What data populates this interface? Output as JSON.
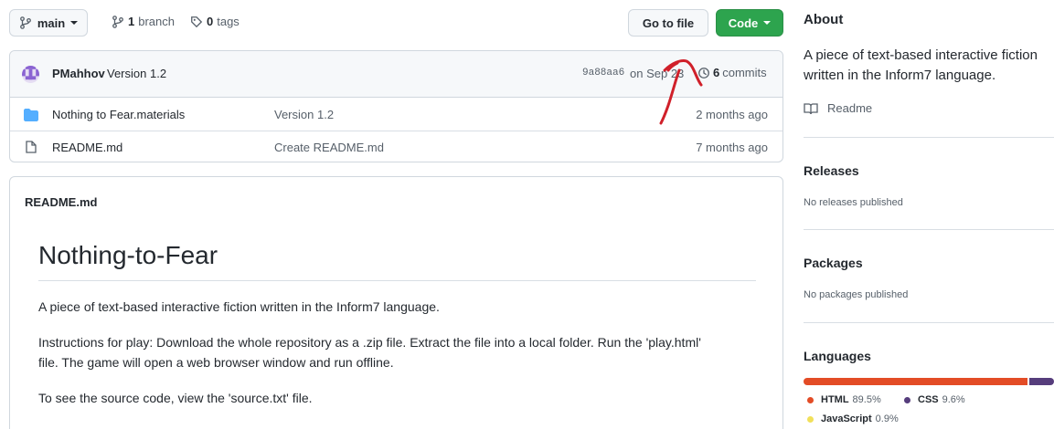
{
  "toolbar": {
    "branch_selector": "main",
    "branches_count": "1",
    "branches_label": "branch",
    "tags_count": "0",
    "tags_label": "tags",
    "go_to_file": "Go to file",
    "code_button": "Code"
  },
  "commit": {
    "author": "PMahhov",
    "message": "Version 1.2",
    "hash": "9a88aa6",
    "date": "on Sep 23",
    "commits_count": "6",
    "commits_label": "commits"
  },
  "files": [
    {
      "name": "Nothing to Fear.materials",
      "message": "Version 1.2",
      "age": "2 months ago",
      "type": "folder"
    },
    {
      "name": "README.md",
      "message": "Create README.md",
      "age": "7 months ago",
      "type": "file"
    }
  ],
  "readme": {
    "filename": "README.md",
    "title": "Nothing-to-Fear",
    "p1": "A piece of text-based interactive fiction written in the Inform7 language.",
    "p2": "Instructions for play: Download the whole repository as a .zip file. Extract the file into a local folder. Run the 'play.html' file. The game will open a web browser window and run offline.",
    "p3": "To see the source code, view the 'source.txt' file."
  },
  "sidebar": {
    "about_heading": "About",
    "about_text": "A piece of text-based interactive fiction written in the Inform7 language.",
    "readme_link": "Readme",
    "releases_heading": "Releases",
    "releases_text": "No releases published",
    "packages_heading": "Packages",
    "packages_text": "No packages published",
    "languages_heading": "Languages",
    "languages": [
      {
        "name": "HTML",
        "percent": "89.5%",
        "value": 89.5,
        "color": "#e34c26"
      },
      {
        "name": "CSS",
        "percent": "9.6%",
        "value": 9.6,
        "color": "#563d7c"
      },
      {
        "name": "JavaScript",
        "percent": "0.9%",
        "value": 0.9,
        "color": "#f1e05a"
      }
    ]
  },
  "colors": {
    "accent_green": "#2da44e",
    "folder_blue": "#54aeff",
    "annotation_red": "#d0202a"
  }
}
